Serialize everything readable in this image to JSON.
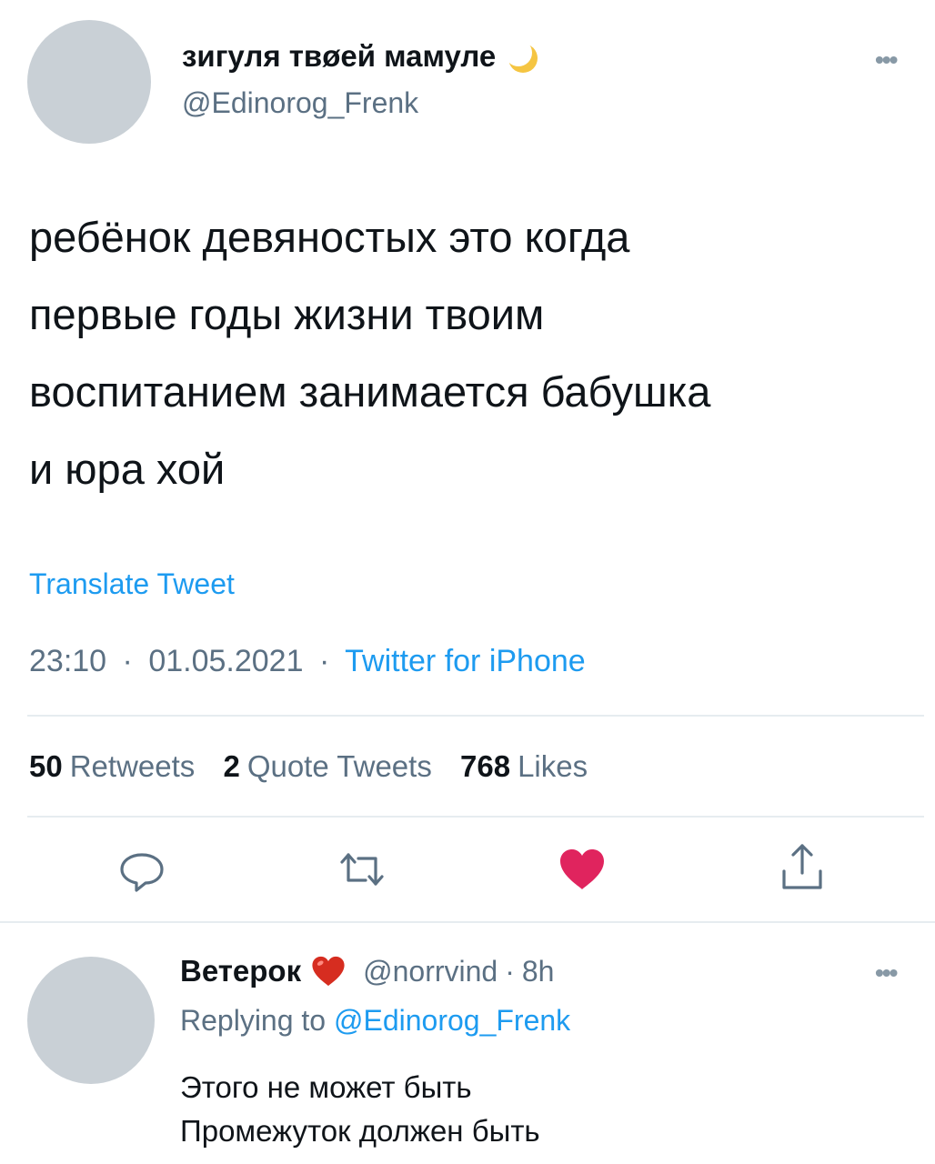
{
  "tweet": {
    "display_name": "зигуля твøей мамуле",
    "name_emoji": "crescent-moon-icon",
    "handle": "@Edinorog_Frenk",
    "text_lines": [
      "ребёнок девяностых это когда",
      "первые годы жизни твоим",
      "воспитанием занимается бабушка",
      "и юра хой"
    ],
    "translate_label": "Translate Tweet",
    "time": "23:10",
    "date": "01.05.2021",
    "separator": "·",
    "source": "Twitter for iPhone",
    "stats": {
      "retweets_count": "50",
      "retweets_label": "Retweets",
      "quotes_count": "2",
      "quotes_label": "Quote Tweets",
      "likes_count": "768",
      "likes_label": "Likes"
    },
    "actions": [
      "reply-icon",
      "retweet-icon",
      "like-icon",
      "share-icon"
    ],
    "liked": true
  },
  "reply": {
    "display_name": "Ветерок",
    "name_emoji": "red-heart-icon",
    "handle": "@norrvind",
    "separator": "·",
    "time_ago": "8h",
    "replying_to_label": "Replying to",
    "replying_to_handle": "@Edinorog_Frenk",
    "text_lines": [
      "Этого не может быть",
      "Промежуток должен быть"
    ]
  },
  "colors": {
    "link": "#1d9bf0",
    "secondary_text": "#5b7083",
    "like": "#e0245e",
    "divider": "#e6ecf0",
    "avatar_placeholder": "#c9d0d6"
  }
}
